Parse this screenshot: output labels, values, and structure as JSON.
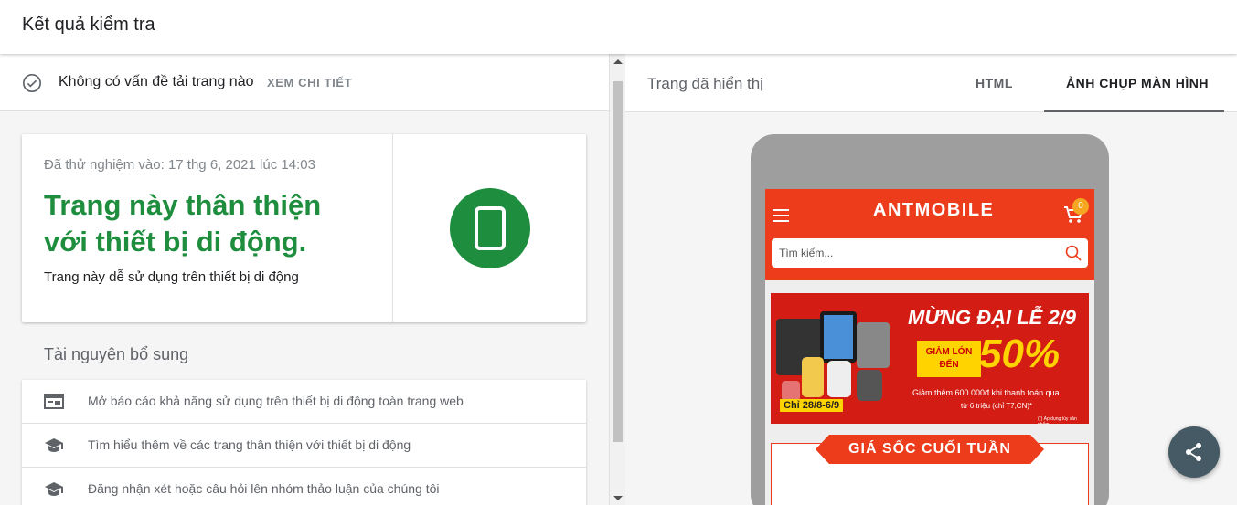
{
  "header": {
    "title": "Kết quả kiểm tra"
  },
  "status": {
    "message": "Không có vấn đề tải trang nào",
    "details_label": "XEM CHI TIẾT"
  },
  "result_card": {
    "tested_at": "Đã thử nghiệm vào: 17 thg 6, 2021 lúc 14:03",
    "verdict_line1": "Trang này thân thiện",
    "verdict_line2": "với thiết bị di động.",
    "subtitle": "Trang này dễ sử dụng trên thiết bị di động",
    "badge_color": "#1e8e3e"
  },
  "resources": {
    "title": "Tài nguyên bổ sung",
    "items": [
      {
        "icon": "web-report-icon",
        "label": "Mở báo cáo khả năng sử dụng trên thiết bị di động toàn trang web"
      },
      {
        "icon": "school-icon",
        "label": "Tìm hiểu thêm về các trang thân thiện với thiết bị di động"
      },
      {
        "icon": "school-icon",
        "label": "Đăng nhận xét hoặc câu hỏi lên nhóm thảo luận của chúng tôi"
      }
    ]
  },
  "right_pane": {
    "rendered_label": "Trang đã hiển thị",
    "tabs": [
      {
        "label": "HTML",
        "active": false
      },
      {
        "label": "ẢNH CHỤP MÀN HÌNH",
        "active": true
      }
    ]
  },
  "screenshot": {
    "logo": "ANTMOBILE",
    "cart_count": "0",
    "search_placeholder": "Tìm kiếm...",
    "banner": {
      "headline": "MỪNG ĐẠI LỄ 2/9",
      "discount_label_1": "GIẢM LỚN",
      "discount_label_2": "ĐẾN",
      "discount_value": "50%",
      "promo_line": "Giảm thêm 600.000đ khi thanh toán qua",
      "promo_line2": "từ 6 triệu (chỉ T7,CN)*",
      "date": "Chỉ 28/8-6/9",
      "note": "(*) Áp dụng tùy sản phẩm"
    },
    "deal_title": "GIÁ SỐC CUỐI TUẦN",
    "brand_color": "#ec3c1c"
  },
  "fab": {
    "icon": "share-icon"
  }
}
